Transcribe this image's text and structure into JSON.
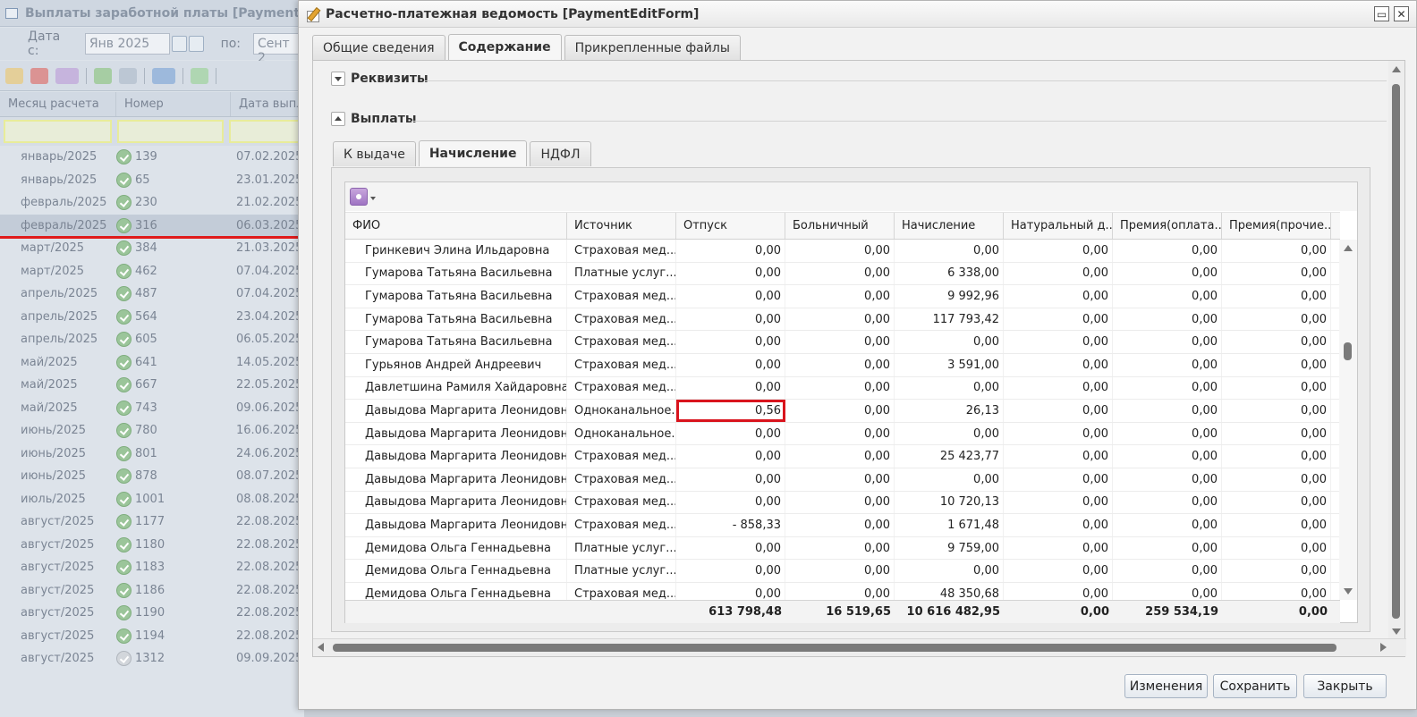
{
  "bg_window": {
    "title": "Выплаты заработной платы [PaymentListF",
    "date_from_label": "Дата с:",
    "date_from_value": "Янв 2025",
    "date_to_label": "по:",
    "date_to_value": "Сент 2",
    "columns": [
      "Месяц расчета",
      "Номер",
      "Дата выпла"
    ],
    "rows": [
      {
        "month": "январь/2025",
        "number": "139",
        "date": "07.02.2025",
        "status": "ok"
      },
      {
        "month": "январь/2025",
        "number": "65",
        "date": "23.01.2025",
        "status": "ok"
      },
      {
        "month": "февраль/2025",
        "number": "230",
        "date": "21.02.2025",
        "status": "ok"
      },
      {
        "month": "февраль/2025",
        "number": "316",
        "date": "06.03.2025",
        "status": "ok",
        "selected": true
      },
      {
        "month": "март/2025",
        "number": "384",
        "date": "21.03.2025",
        "status": "ok"
      },
      {
        "month": "март/2025",
        "number": "462",
        "date": "07.04.2025",
        "status": "ok"
      },
      {
        "month": "апрель/2025",
        "number": "487",
        "date": "07.04.2025",
        "status": "ok"
      },
      {
        "month": "апрель/2025",
        "number": "564",
        "date": "23.04.2025",
        "status": "ok"
      },
      {
        "month": "апрель/2025",
        "number": "605",
        "date": "06.05.2025",
        "status": "ok"
      },
      {
        "month": "май/2025",
        "number": "641",
        "date": "14.05.2025",
        "status": "ok"
      },
      {
        "month": "май/2025",
        "number": "667",
        "date": "22.05.2025",
        "status": "ok"
      },
      {
        "month": "май/2025",
        "number": "743",
        "date": "09.06.2025",
        "status": "ok"
      },
      {
        "month": "июнь/2025",
        "number": "780",
        "date": "16.06.2025",
        "status": "ok"
      },
      {
        "month": "июнь/2025",
        "number": "801",
        "date": "24.06.2025",
        "status": "ok"
      },
      {
        "month": "июнь/2025",
        "number": "878",
        "date": "08.07.2025",
        "status": "ok"
      },
      {
        "month": "июль/2025",
        "number": "1001",
        "date": "08.08.2025",
        "status": "ok"
      },
      {
        "month": "август/2025",
        "number": "1177",
        "date": "22.08.2025",
        "status": "ok"
      },
      {
        "month": "август/2025",
        "number": "1180",
        "date": "22.08.2025",
        "status": "ok"
      },
      {
        "month": "август/2025",
        "number": "1183",
        "date": "22.08.2025",
        "status": "ok"
      },
      {
        "month": "август/2025",
        "number": "1186",
        "date": "22.08.2025",
        "status": "ok"
      },
      {
        "month": "август/2025",
        "number": "1190",
        "date": "22.08.2025",
        "status": "ok"
      },
      {
        "month": "август/2025",
        "number": "1194",
        "date": "22.08.2025",
        "status": "ok"
      },
      {
        "month": "август/2025",
        "number": "1312",
        "date": "09.09.2025",
        "status": "pending"
      }
    ]
  },
  "dialog": {
    "title": "Расчетно-платежная ведомость [PaymentEditForm]",
    "outer_tabs": [
      "Общие сведения",
      "Содержание",
      "Прикрепленные файлы"
    ],
    "outer_active": 1,
    "section_requisites": "Реквизиты",
    "section_payments": "Выплаты",
    "inner_tabs": [
      "К выдаче",
      "Начисление",
      "НДФЛ"
    ],
    "inner_active": 1,
    "columns": [
      "ФИО",
      "Источник",
      "Отпуск",
      "Больничный",
      "Начисление",
      "Натуральный д...",
      "Премия(оплата...",
      "Премия(прочие..."
    ],
    "rows": [
      [
        "Гринкевич Элина Ильдаровна",
        "Страховая мед...",
        "0,00",
        "0,00",
        "0,00",
        "0,00",
        "0,00",
        "0,00"
      ],
      [
        "Гумарова Татьяна Васильевна",
        "Платные услуг...",
        "0,00",
        "0,00",
        "6 338,00",
        "0,00",
        "0,00",
        "0,00"
      ],
      [
        "Гумарова Татьяна Васильевна",
        "Страховая мед...",
        "0,00",
        "0,00",
        "9 992,96",
        "0,00",
        "0,00",
        "0,00"
      ],
      [
        "Гумарова Татьяна Васильевна",
        "Страховая мед...",
        "0,00",
        "0,00",
        "117 793,42",
        "0,00",
        "0,00",
        "0,00"
      ],
      [
        "Гумарова Татьяна Васильевна",
        "Страховая мед...",
        "0,00",
        "0,00",
        "0,00",
        "0,00",
        "0,00",
        "0,00"
      ],
      [
        "Гурьянов Андрей Андреевич",
        "Страховая мед...",
        "0,00",
        "0,00",
        "3 591,00",
        "0,00",
        "0,00",
        "0,00"
      ],
      [
        "Давлетшина Рамиля Хайдаровна",
        "Страховая мед...",
        "0,00",
        "0,00",
        "0,00",
        "0,00",
        "0,00",
        "0,00"
      ],
      [
        "Давыдова Маргарита Леонидовна",
        "Одноканальное...",
        "0,56",
        "0,00",
        "26,13",
        "0,00",
        "0,00",
        "0,00"
      ],
      [
        "Давыдова Маргарита Леонидовна",
        "Одноканальное...",
        "0,00",
        "0,00",
        "0,00",
        "0,00",
        "0,00",
        "0,00"
      ],
      [
        "Давыдова Маргарита Леонидовна",
        "Страховая мед...",
        "0,00",
        "0,00",
        "25 423,77",
        "0,00",
        "0,00",
        "0,00"
      ],
      [
        "Давыдова Маргарита Леонидовна",
        "Страховая мед...",
        "0,00",
        "0,00",
        "0,00",
        "0,00",
        "0,00",
        "0,00"
      ],
      [
        "Давыдова Маргарита Леонидовна",
        "Страховая мед...",
        "0,00",
        "0,00",
        "10 720,13",
        "0,00",
        "0,00",
        "0,00"
      ],
      [
        "Давыдова Маргарита Леонидовна",
        "Страховая мед...",
        "- 858,33",
        "0,00",
        "1 671,48",
        "0,00",
        "0,00",
        "0,00"
      ],
      [
        "Демидова Ольга Геннадьевна",
        "Платные услуг...",
        "0,00",
        "0,00",
        "9 759,00",
        "0,00",
        "0,00",
        "0,00"
      ],
      [
        "Демидова Ольга Геннадьевна",
        "Платные услуг...",
        "0,00",
        "0,00",
        "0,00",
        "0,00",
        "0,00",
        "0,00"
      ],
      [
        "Демидова Ольга Геннадьевна",
        "Страховая мед...",
        "0,00",
        "0,00",
        "48 350,68",
        "0,00",
        "0,00",
        "0,00"
      ]
    ],
    "highlight": {
      "row": 7,
      "col": 2
    },
    "totals": [
      "",
      "",
      "613 798,48",
      "16 519,65",
      "10 616 482,95",
      "0,00",
      "259 534,19",
      "0,00"
    ],
    "buttons": {
      "changes": "Изменения",
      "save": "Сохранить",
      "close": "Закрыть"
    }
  },
  "colors": {
    "highlight": "#d9141d",
    "selection_underline": "#e01b1b"
  }
}
